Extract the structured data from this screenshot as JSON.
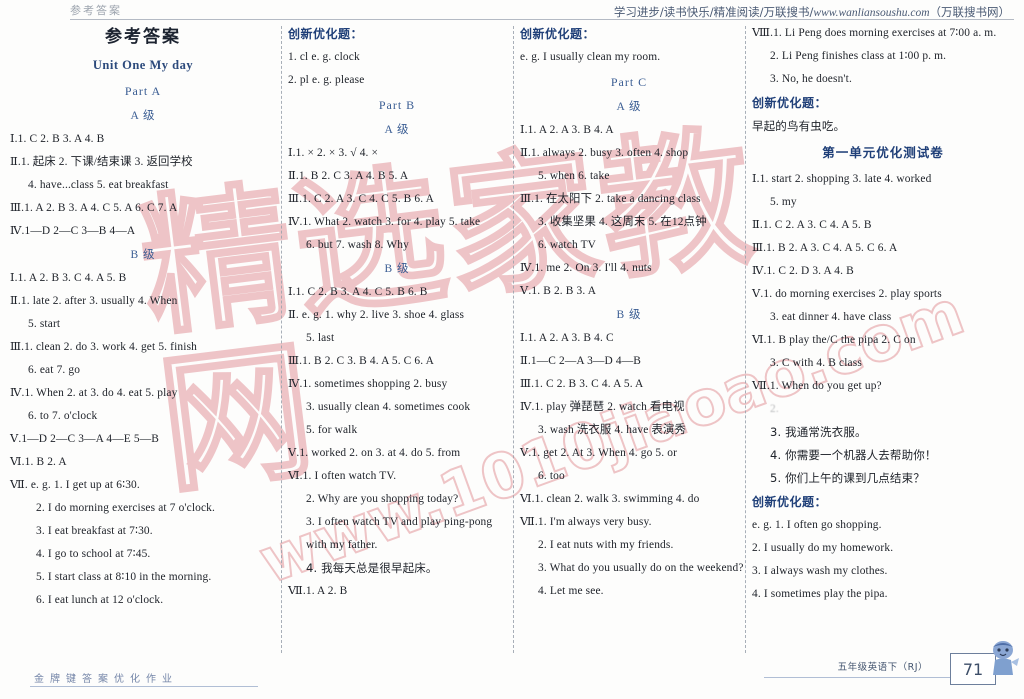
{
  "header": {
    "left_mark": "参考答案",
    "right_text_cn1": "学习进步/读书快乐/精准阅读/万联搜书/",
    "right_url": "www.wanliansoushu.com",
    "right_text_cn2": "（万联搜书网）"
  },
  "watermark": {
    "cn": "精选家教网",
    "url": "www.1010jiaoao.com"
  },
  "footer": {
    "left_decor": "金牌键答案优化作业",
    "book": "五年级英语下（RJ）",
    "page": "71"
  },
  "col1": {
    "title": "参考答案",
    "unit": "Unit One    My day",
    "part": "Part A",
    "grade_a": "A 级",
    "grade_b": "B 级",
    "a_lines": [
      "Ⅰ.1. C   2. B   3. A   4. B",
      "Ⅱ.1. 起床    2. 下课/结束课    3. 返回学校",
      "4. have...class    5. eat breakfast",
      "Ⅲ.1. A   2. B   3. A   4. C   5. A   6. C   7. A",
      "Ⅳ.1—D   2—C   3—B   4—A"
    ],
    "b_lines": [
      "Ⅰ.1. A   2. B   3. C   4. A   5. B",
      "Ⅱ.1. late    2. after    3. usually    4. When",
      "5. start",
      "Ⅲ.1. clean   2. do   3. work   4. get   5. finish",
      "6. eat   7. go",
      "Ⅳ.1. When   2. at   3. do   4. eat   5. play",
      "6. to   7. o'clock",
      "Ⅴ.1—D   2—C   3—A   4—E   5—B",
      "Ⅵ.1. B   2. A",
      "Ⅶ. e. g. 1. I get up at 6∶30.",
      "2. I do morning exercises at 7 o'clock.",
      "3. I eat breakfast at 7∶30.",
      "4. I go to school at 7∶45.",
      "5. I start class at 8∶10 in the morning.",
      "6. I eat lunch at 12 o'clock."
    ]
  },
  "col2": {
    "innov_head": "创新优化题：",
    "innov_lines": [
      "1. cl    e. g. clock",
      "2. pl    e. g. please"
    ],
    "part": "Part B",
    "grade_a": "A 级",
    "grade_b": "B 级",
    "a_lines": [
      "Ⅰ.1. ×    2. ×    3. √    4. ×",
      "Ⅱ.1. B   2. C   3. A    4. B   5. A",
      "Ⅲ.1. C   2. A   3. C   4. C   5. B   6. A",
      "Ⅳ.1. What   2. watch   3. for   4. play   5. take",
      "6. but   7. wash   8. Why"
    ],
    "b_lines": [
      "Ⅰ.1. C   2. B   3. A   4. C   5. B   6. B",
      "Ⅱ. e. g. 1. why    2. live    3. shoe    4. glass",
      "5. last",
      "Ⅲ.1. B   2. C   3. B   4. A   5. C   6. A",
      "Ⅳ.1. sometimes   shopping   2. busy",
      "3. usually clean   4. sometimes   cook",
      "5. for   walk",
      "Ⅴ.1. worked   2. on   3. at   4. do   5. from",
      "Ⅵ.1. I often watch TV.",
      "2. Why are you shopping today?",
      "3. I often watch TV and play ping-pong with my father.",
      "4. 我每天总是很早起床。",
      "Ⅶ.1. A   2. B"
    ]
  },
  "col3": {
    "innov_head": "创新优化题：",
    "innov_lines": [
      "e. g. I usually clean my room."
    ],
    "part": "Part C",
    "grade_a": "A 级",
    "grade_b": "B 级",
    "a_lines": [
      "Ⅰ.1. A   2. A   3. B   4. A",
      "Ⅱ.1. always   2. busy   3. often   4. shop",
      "5. when   6. take",
      "Ⅲ.1. 在太阳下   2. take a dancing class",
      "3. 收集坚果   4. 这周末   5. 在12点钟",
      "6. watch TV",
      "Ⅳ.1. me   2. On   3. I'll   4. nuts",
      "Ⅴ.1. B   2. B   3. A"
    ],
    "b_lines": [
      "Ⅰ.1. A   2. A   3. B   4. C",
      "Ⅱ.1—C   2—A   3—D   4—B",
      "Ⅲ.1. C   2. B   3. C   4. A   5. A",
      "Ⅳ.1. play   弹琵琶   2. watch   看电视",
      "3. wash   洗衣服   4. have   表演秀",
      "Ⅴ.1. get   2. At   3. When   4. go   5. or",
      "6. too",
      "Ⅵ.1. clean   2. walk   3. swimming   4. do",
      "Ⅶ.1. I'm always very busy.",
      "2. I eat nuts with my friends.",
      "3. What do you usually do on the weekend?",
      "4. Let me see."
    ]
  },
  "col4": {
    "top_lines": [
      "Ⅷ.1. Li Peng does morning exercises at 7∶00 a. m.",
      "2. Li Peng finishes class at 1∶00 p. m.",
      "3. No, he doesn't."
    ],
    "innov_head": "创新优化题：",
    "innov_lines": [
      "早起的鸟有虫吃。"
    ],
    "test_title": "第一单元优化测试卷",
    "test_lines": [
      "Ⅰ.1. start   2. shopping   3. late   4. worked",
      "5. my",
      "Ⅱ.1. C   2. A   3. C   4. A   5. B",
      "Ⅲ.1. B   2. A   3. C   4. A   5. C   6. A",
      "Ⅳ.1. C   2. D   3. A   4. B",
      "Ⅴ.1. do morning exercises   2. play sports",
      "3. eat dinner   4. have   class",
      "Ⅵ.1. B   play the/C   the pipa   2. C   on",
      "3. C   with   4. B   class",
      "Ⅶ.1. When do you get up?",
      "2.",
      "3. 我通常洗衣服。",
      "4. 你需要一个机器人去帮助你！",
      "5. 你们上午的课到几点结束？"
    ],
    "innov2_head": "创新优化题：",
    "innov2_lines": [
      "e. g. 1. I often go shopping.",
      "2. I usually do my homework.",
      "3. I always wash my clothes.",
      "4. I sometimes play the pipa."
    ]
  }
}
